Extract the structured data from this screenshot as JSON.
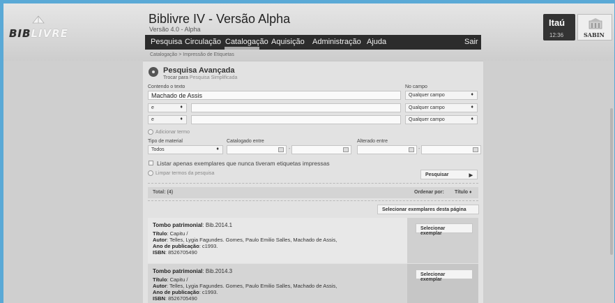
{
  "app": {
    "title": "Biblivre IV - Versão Alpha",
    "version": "Versão 4.0 - Alpha",
    "logo_text_a": "BIB",
    "logo_text_b": "LIVRE"
  },
  "menu": {
    "items": [
      "Pesquisa",
      "Circulação",
      "Catalogação",
      "Aquisição",
      "Administração",
      "Ajuda"
    ],
    "logout": "Sair",
    "active": "Catalogação"
  },
  "sponsors": {
    "itau": "Itaú",
    "clock": "12:36",
    "sabin": "SABIN"
  },
  "breadcrumb": "Catalogação > Impressão de Etiquetas",
  "search": {
    "title": "Pesquisa Avançada",
    "switch_prefix": "Trocar para",
    "switch_link": "Pesquisa Simplificada",
    "contains_label": "Contendo o texto",
    "field_label": "No campo",
    "term1": "Machado de Assis",
    "field1": "Qualquer campo",
    "op2": "e",
    "term2": "",
    "field2": "Qualquer campo",
    "op3": "e",
    "term3": "",
    "field3": "Qualquer campo",
    "add_term": "Adicionar termo",
    "material_label": "Tipo de material",
    "material_value": "Todos",
    "cataloged_label": "Catalogado entre",
    "changed_label": "Alterado entre",
    "never_printed": "Listar apenas exemplares que nunca tiveram etiquetas impressas",
    "clear_terms": "Limpar termos da pesquisa",
    "search_button": "Pesquisar"
  },
  "results": {
    "total": "Total: (4)",
    "order_label": "Ordenar por:",
    "order_value": "Título",
    "select_page_button": "Selecionar exemplares desta página",
    "select_button": "Selecionar exemplar",
    "items": [
      {
        "tombo_label": "Tombo patrimonial",
        "tombo": "Bib.2014.1",
        "titulo_label": "Título",
        "titulo": "Capitu /",
        "autor_label": "Autor",
        "autor": "Telles, Lygia Fagundes. Gomes, Paulo Emilio Salles, Machado de Assis,",
        "ano_label": "Ano de publicação",
        "ano": "c1993.",
        "isbn_label": "ISBN",
        "isbn": "8526705490"
      },
      {
        "tombo_label": "Tombo patrimonial",
        "tombo": "Bib.2014.3",
        "titulo_label": "Título",
        "titulo": "Capitu /",
        "autor_label": "Autor",
        "autor": "Telles, Lygia Fagundes. Gomes, Paulo Emilio Salles, Machado de Assis,",
        "ano_label": "Ano de publicação",
        "ano": "c1993.",
        "isbn_label": "ISBN",
        "isbn": "8526705490"
      }
    ]
  },
  "colors": {
    "outer_border": "#5aa9d6",
    "menubar": "#2c2c2c",
    "content_bg": "#e2e2e2"
  }
}
